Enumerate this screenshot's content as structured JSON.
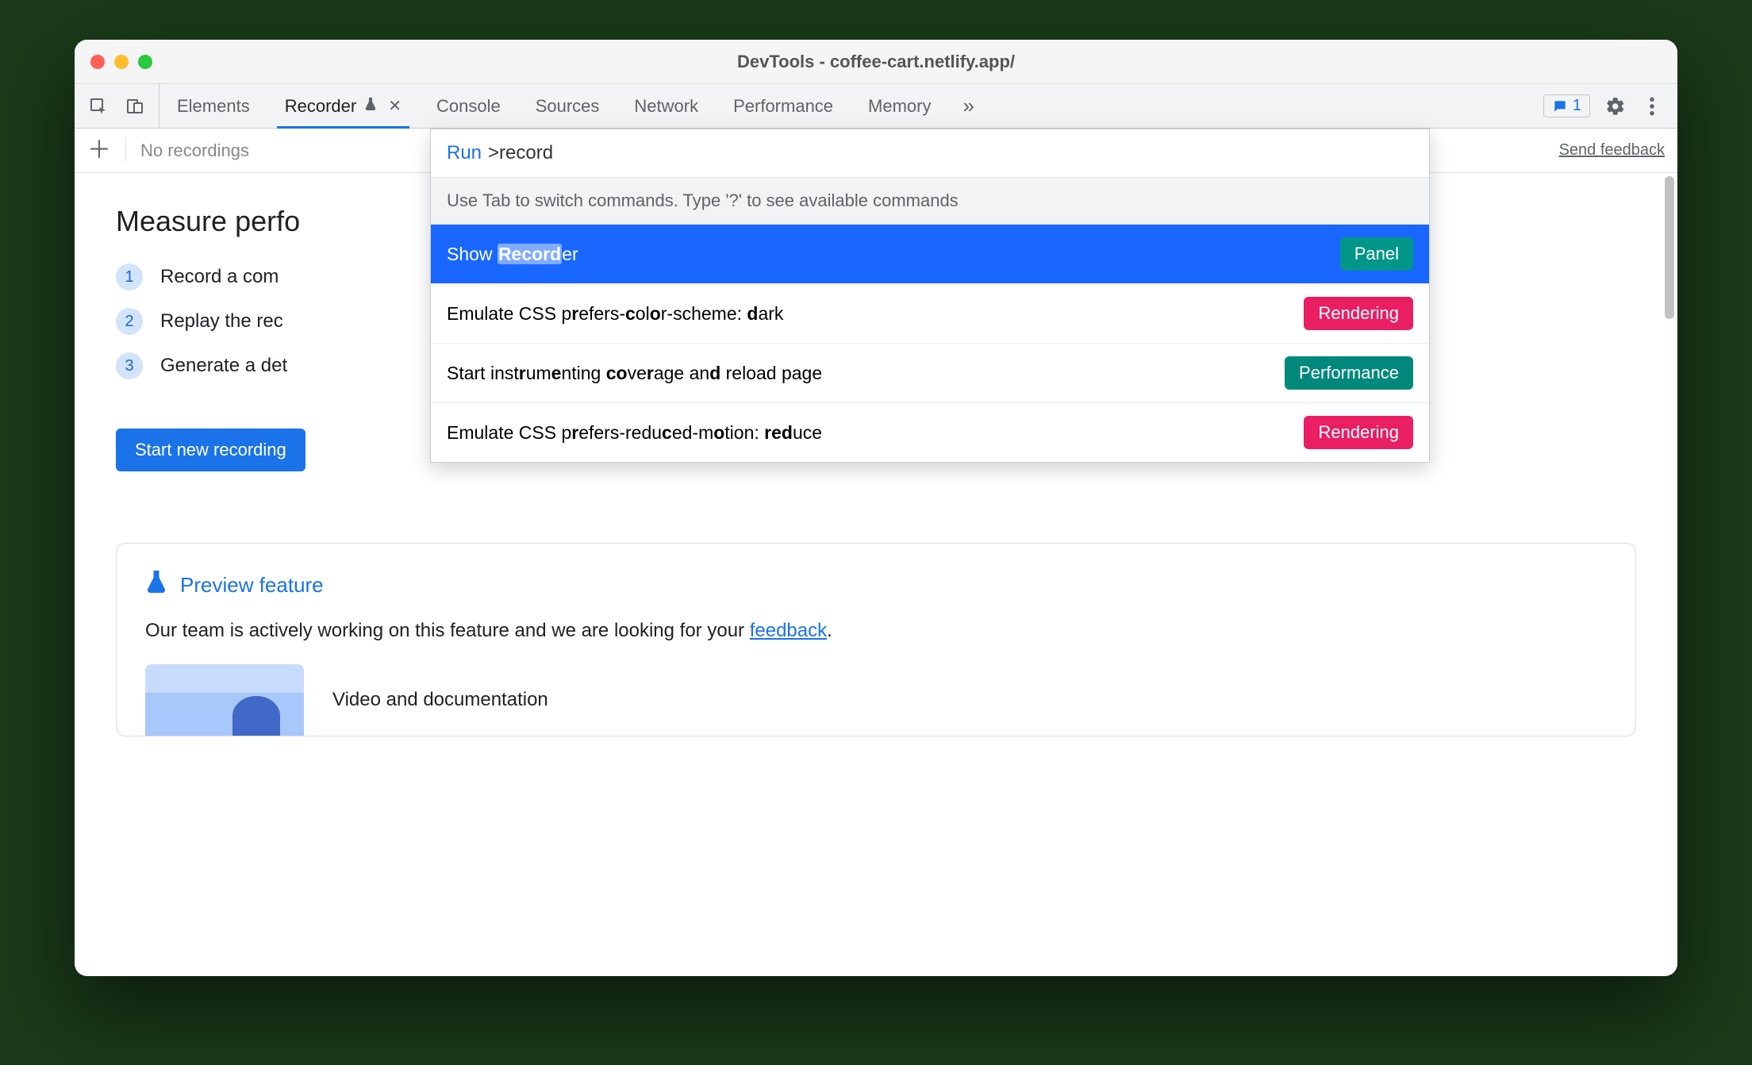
{
  "window": {
    "title": "DevTools - coffee-cart.netlify.app/"
  },
  "tabs": {
    "items": [
      "Elements",
      "Recorder",
      "Console",
      "Sources",
      "Network",
      "Performance",
      "Memory"
    ],
    "active_index": 1,
    "overflow_glyph": "»"
  },
  "messages": {
    "count": "1"
  },
  "subbar": {
    "placeholder": "No recordings",
    "feedback": "Send feedback"
  },
  "page": {
    "heading": "Measure perfo",
    "steps": [
      "Record a com",
      "Replay the rec",
      "Generate a det"
    ],
    "primary_button": "Start new recording"
  },
  "preview": {
    "title": "Preview feature",
    "body_prefix": "Our team is actively working on this feature and we are looking for your ",
    "body_link": "feedback",
    "body_suffix": ".",
    "media_title": "Video and documentation"
  },
  "cmd": {
    "run_label": "Run",
    "prompt": ">record",
    "hint": "Use Tab to switch commands. Type '?' to see available commands",
    "items": [
      {
        "html": "Show <span class='match-hl'><b>Record</b></span>er",
        "badge": "Panel",
        "badge_cls": "teal",
        "selected": true
      },
      {
        "html": "Emulate CSS p<b>r</b>efers-<b>c</b>ol<b>o</b>r-scheme: <b>d</b>ark",
        "badge": "Rendering",
        "badge_cls": "pink",
        "selected": false
      },
      {
        "html": "Start inst<b>r</b>um<b>e</b>nting <b>co</b>ve<b>r</b>age an<b>d</b> reload page",
        "badge": "Performance",
        "badge_cls": "tealdark",
        "selected": false
      },
      {
        "html": "Emulate CSS p<b>r</b>efers-redu<b>c</b>ed-m<b>o</b>tion: <b>red</b>uce",
        "badge": "Rendering",
        "badge_cls": "pink",
        "selected": false
      }
    ]
  }
}
